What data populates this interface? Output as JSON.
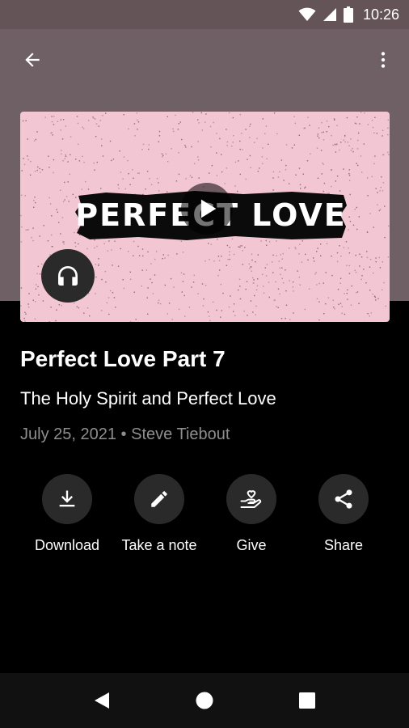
{
  "status_bar": {
    "time": "10:26",
    "icons": [
      "wifi-icon",
      "cell-signal-icon",
      "battery-icon"
    ]
  },
  "toolbar": {
    "back_icon": "arrow-back-icon",
    "more_icon": "more-vert-icon"
  },
  "artwork": {
    "text": "PERFECT LOVE",
    "background_color": "#f2c6d2",
    "play_icon": "play-icon",
    "badge_icon": "headphones-icon"
  },
  "content": {
    "title": "Perfect Love Part 7",
    "subtitle": "The Holy Spirit and Perfect Love",
    "date": "July 25, 2021",
    "separator": "•",
    "speaker": "Steve Tiebout"
  },
  "actions": [
    {
      "label": "Download",
      "icon": "download-icon"
    },
    {
      "label": "Take a note",
      "icon": "pencil-icon"
    },
    {
      "label": "Give",
      "icon": "give-heart-hand-icon"
    },
    {
      "label": "Share",
      "icon": "share-icon"
    }
  ],
  "nav_bar": {
    "icons": [
      "nav-back-icon",
      "nav-home-icon",
      "nav-recents-icon"
    ]
  },
  "colors": {
    "header": "#6f6065",
    "status_bar": "#645458",
    "background": "#000000",
    "button_circle": "#2a2a2a",
    "meta_text": "#8e8e8e"
  }
}
